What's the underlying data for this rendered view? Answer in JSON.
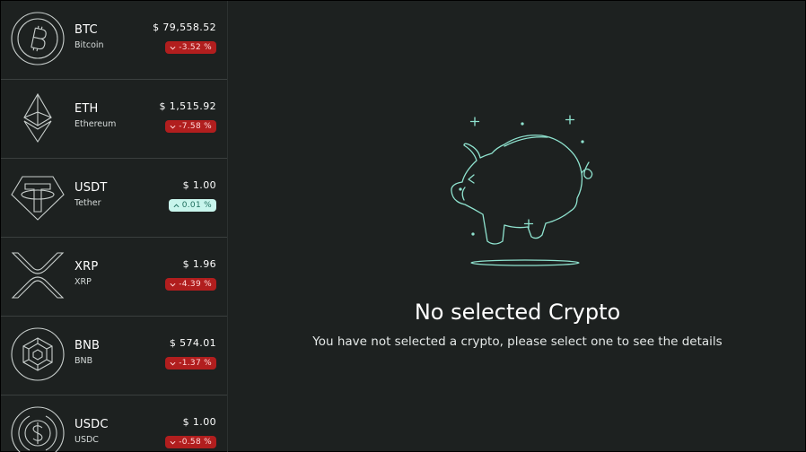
{
  "coins": [
    {
      "symbol": "BTC",
      "name": "Bitcoin",
      "price": "$ 79,558.52",
      "change": "-3.52 %",
      "direction": "down",
      "icon": "bitcoin-icon"
    },
    {
      "symbol": "ETH",
      "name": "Ethereum",
      "price": "$ 1,515.92",
      "change": "-7.58 %",
      "direction": "down",
      "icon": "ethereum-icon"
    },
    {
      "symbol": "USDT",
      "name": "Tether",
      "price": "$ 1.00",
      "change": "0.01 %",
      "direction": "up",
      "icon": "tether-icon"
    },
    {
      "symbol": "XRP",
      "name": "XRP",
      "price": "$ 1.96",
      "change": "-4.39 %",
      "direction": "down",
      "icon": "xrp-icon"
    },
    {
      "symbol": "BNB",
      "name": "BNB",
      "price": "$ 574.01",
      "change": "-1.37 %",
      "direction": "down",
      "icon": "bnb-icon"
    },
    {
      "symbol": "USDC",
      "name": "USDC",
      "price": "$ 1.00",
      "change": "-0.58 %",
      "direction": "down",
      "icon": "usdc-icon"
    }
  ],
  "empty_state": {
    "title": "No selected Crypto",
    "subtitle": "You have not selected a crypto, please select one to see the details",
    "illustration": "piggy-bank-icon"
  },
  "colors": {
    "background": "#1d2120",
    "negative": "#b11e1e",
    "positive": "#c8f5ec",
    "illustration_stroke": "#8fe3cf"
  }
}
